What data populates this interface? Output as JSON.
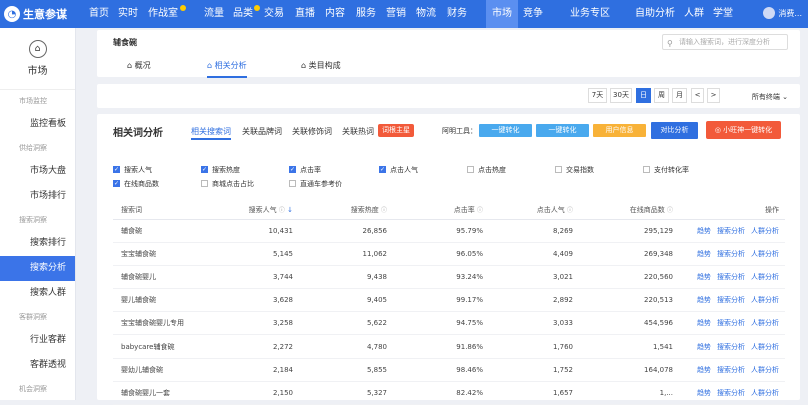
{
  "header": {
    "logo": "生意参谋",
    "nav": [
      "首页",
      "实时",
      "作战室",
      "流量",
      "品类",
      "交易",
      "直播",
      "内容",
      "服务",
      "营销",
      "物流",
      "财务",
      "市场",
      "竞争",
      "业务专区",
      "自助分析",
      "人群",
      "学堂"
    ],
    "active_nav": "市场",
    "user": "消费..."
  },
  "sidebar": {
    "title": "市场",
    "groups": [
      {
        "label": "市场监控",
        "items": [
          "监控看板"
        ]
      },
      {
        "label": "供给洞察",
        "items": [
          "市场大盘",
          "市场排行"
        ]
      },
      {
        "label": "搜索洞察",
        "items": [
          "搜索排行",
          "搜索分析",
          "搜索人群"
        ]
      },
      {
        "label": "客群洞察",
        "items": [
          "行业客群",
          "客群透视"
        ]
      },
      {
        "label": "机会洞察",
        "items": []
      }
    ],
    "active": "搜索分析"
  },
  "top_panel": {
    "breadcrumb": "辅食碗",
    "search_placeholder": "请输入搜索词，进行深度分析",
    "tabs": [
      "概况",
      "相关分析",
      "类目构成"
    ],
    "active_tab": "相关分析"
  },
  "date_bar": {
    "buttons": [
      "7天",
      "30天",
      "日",
      "周",
      "月",
      "<",
      ">"
    ],
    "active": "日",
    "terminal": "所有终端"
  },
  "analysis": {
    "title": "相关词分析",
    "subtabs": [
      "相关搜索词",
      "关联品牌词",
      "关联修饰词",
      "关联热词"
    ],
    "active_subtab": "相关搜索词",
    "hot_label": "词根主星",
    "tools_label": "阿明工具：",
    "tool_buttons": [
      {
        "label": "一键转化",
        "color": "#49a9ee"
      },
      {
        "label": "一键转化",
        "color": "#49a9ee"
      },
      {
        "label": "用户信息",
        "color": "#f8b238"
      },
      {
        "label": "对比分析",
        "color": "#2f6fe0"
      }
    ],
    "extra_button": "小旺神一键转化",
    "checkboxes_row1": [
      {
        "label": "搜索人气",
        "checked": true
      },
      {
        "label": "搜索热度",
        "checked": true
      },
      {
        "label": "点击率",
        "checked": true
      },
      {
        "label": "点击人气",
        "checked": true
      },
      {
        "label": "点击热度",
        "checked": false
      },
      {
        "label": "交易指数",
        "checked": false
      },
      {
        "label": "支付转化率",
        "checked": false
      }
    ],
    "checkboxes_row2": [
      {
        "label": "在线商品数",
        "checked": true
      },
      {
        "label": "商城点击占比",
        "checked": false
      },
      {
        "label": "直通车参考价",
        "checked": false
      }
    ],
    "columns": [
      "搜索词",
      "搜索人气",
      "搜索热度",
      "点击率",
      "点击人气",
      "在线商品数",
      "操作"
    ],
    "rows": [
      {
        "word": "辅食碗",
        "popularity": "10,431",
        "heat": "26,856",
        "ctr": "95.79%",
        "clicks": "8,269",
        "items": "295,129"
      },
      {
        "word": "宝宝辅食碗",
        "popularity": "5,145",
        "heat": "11,062",
        "ctr": "96.05%",
        "clicks": "4,409",
        "items": "269,348"
      },
      {
        "word": "辅食碗婴儿",
        "popularity": "3,744",
        "heat": "9,438",
        "ctr": "93.24%",
        "clicks": "3,021",
        "items": "220,560"
      },
      {
        "word": "婴儿辅食碗",
        "popularity": "3,628",
        "heat": "9,405",
        "ctr": "99.17%",
        "clicks": "2,892",
        "items": "220,513"
      },
      {
        "word": "宝宝辅食碗婴儿专用",
        "popularity": "3,258",
        "heat": "5,622",
        "ctr": "94.75%",
        "clicks": "3,033",
        "items": "454,596"
      },
      {
        "word": "babycare辅食碗",
        "popularity": "2,272",
        "heat": "4,780",
        "ctr": "91.86%",
        "clicks": "1,760",
        "items": "1,541"
      },
      {
        "word": "婴幼儿辅食碗",
        "popularity": "2,184",
        "heat": "5,855",
        "ctr": "98.46%",
        "clicks": "1,752",
        "items": "164,078"
      },
      {
        "word": "辅食碗婴儿一套",
        "popularity": "2,150",
        "heat": "5,327",
        "ctr": "82.42%",
        "clicks": "1,657",
        "items": "1,..."
      }
    ],
    "ops": [
      "趋势",
      "搜索分析",
      "人群分析"
    ]
  }
}
